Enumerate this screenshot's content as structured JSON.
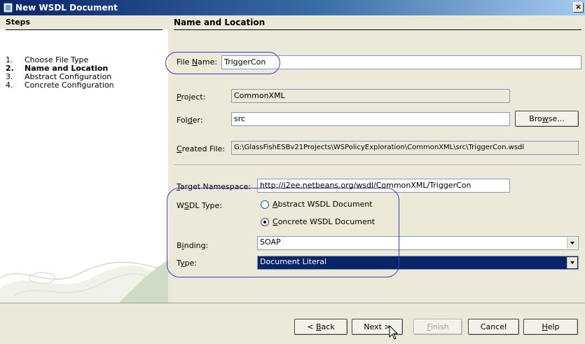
{
  "window": {
    "title": "New WSDL Document",
    "close_symbol": "×"
  },
  "steps": {
    "header": "Steps",
    "items": [
      {
        "num": "1.",
        "label": "Choose File Type"
      },
      {
        "num": "2.",
        "label": "Name and Location"
      },
      {
        "num": "3.",
        "label": "Abstract Configuration"
      },
      {
        "num": "4.",
        "label": "Concrete Configuration"
      }
    ],
    "current_index": 1
  },
  "content": {
    "header": "Name and Location",
    "file_name": {
      "label_pre": "File ",
      "label_mn": "N",
      "label_post": "ame:",
      "value": "TriggerCon"
    },
    "project": {
      "label_mn": "P",
      "label_post": "roject:",
      "value": "CommonXML"
    },
    "folder": {
      "label_pre": "Fol",
      "label_mn": "d",
      "label_post": "er:",
      "value": "src"
    },
    "browse_button": {
      "pre": "Bro",
      "mn": "w",
      "post": "se..."
    },
    "created_file": {
      "label_pre": "",
      "label_mn": "C",
      "label_post": "reated File:",
      "value": "G:\\GlassFishESBv21Projects\\WSPolicyExploration\\CommonXML\\src\\TriggerCon.wsdl"
    },
    "target_namespace": {
      "label_mn": "T",
      "label_post": "arget Namespace:",
      "value": "http://j2ee.netbeans.org/wsdl/CommonXML/TriggerCon"
    },
    "wsdl_type": {
      "label_pre": "W",
      "label_mn": "S",
      "label_post": "DL Type:",
      "options": [
        {
          "mn": "A",
          "rest": "bstract WSDL Document",
          "selected": false
        },
        {
          "mn": "C",
          "rest": "oncrete WSDL Document",
          "selected": true
        }
      ]
    },
    "binding": {
      "label_pre": "B",
      "label_mn": "i",
      "label_post": "nding:",
      "value": "SOAP"
    },
    "type": {
      "label_pre": "T",
      "label_mn": "y",
      "label_post": "pe:",
      "value": "Document Literal"
    }
  },
  "buttons": {
    "back": {
      "pre": "< ",
      "mn": "B",
      "post": "ack"
    },
    "next": {
      "label": "Next >"
    },
    "finish": {
      "pre": "",
      "mn": "F",
      "post": "inish"
    },
    "cancel": {
      "label": "Cancel"
    },
    "help": {
      "pre": "",
      "mn": "H",
      "post": "elp"
    }
  },
  "colors": {
    "titlebar": "#0a246a",
    "selection": "#0a246a",
    "annotation": "#3a3ad8"
  }
}
